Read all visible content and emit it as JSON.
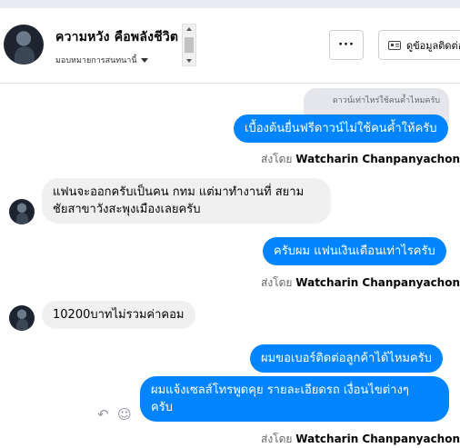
{
  "header": {
    "name": "ความหวัง คือพลังชีวิต",
    "subtitle": "มอบหมายการสนทนานี้",
    "more_button_label": "···",
    "info_button_label": "ดูข้อมูลติดต่อ"
  },
  "conversation": {
    "quoted_reply": "ดาวน์เท่าไหร่ใช้คนค้ำไหมครับ",
    "messages": [
      {
        "direction": "out",
        "text": "เบื้องต้นยื่นฟรีดาวน์ไม่ใช้คนค้ำให้ครับ"
      },
      {
        "direction": "in",
        "lines": [
          "แฟนจะออกครับเป็นคน กทม แต่มาทำงานที่ สยาม",
          "ชัยสาขาวังสะพุงเมืองเลยครับ"
        ]
      },
      {
        "direction": "out",
        "text": "ครับผม แฟนเงินเดือนเท่าไรครับ"
      },
      {
        "direction": "in",
        "text": "10200บาทไม่รวมค่าคอม"
      },
      {
        "direction": "out",
        "text": "ผมขอเบอร์ติดต่อลูกค้าได้ไหมครับ"
      },
      {
        "direction": "out",
        "lines": [
          "ผมแจ้งเซลส์โทรพูดคุย รายละเอียดรถ เงื่อนไขต่างๆ",
          "ครับ"
        ]
      }
    ],
    "sent_by_prefix": "ส่งโดย",
    "sent_by_name": "Watcharin Chanpanyachon",
    "help_icon": "?"
  },
  "icons": {
    "reply": "reply-icon",
    "emoji": "emoji-icon"
  },
  "colors": {
    "outgoing_bubble": "#0084ff",
    "incoming_bubble": "#f0f0f0",
    "meta_text": "#65676b"
  }
}
